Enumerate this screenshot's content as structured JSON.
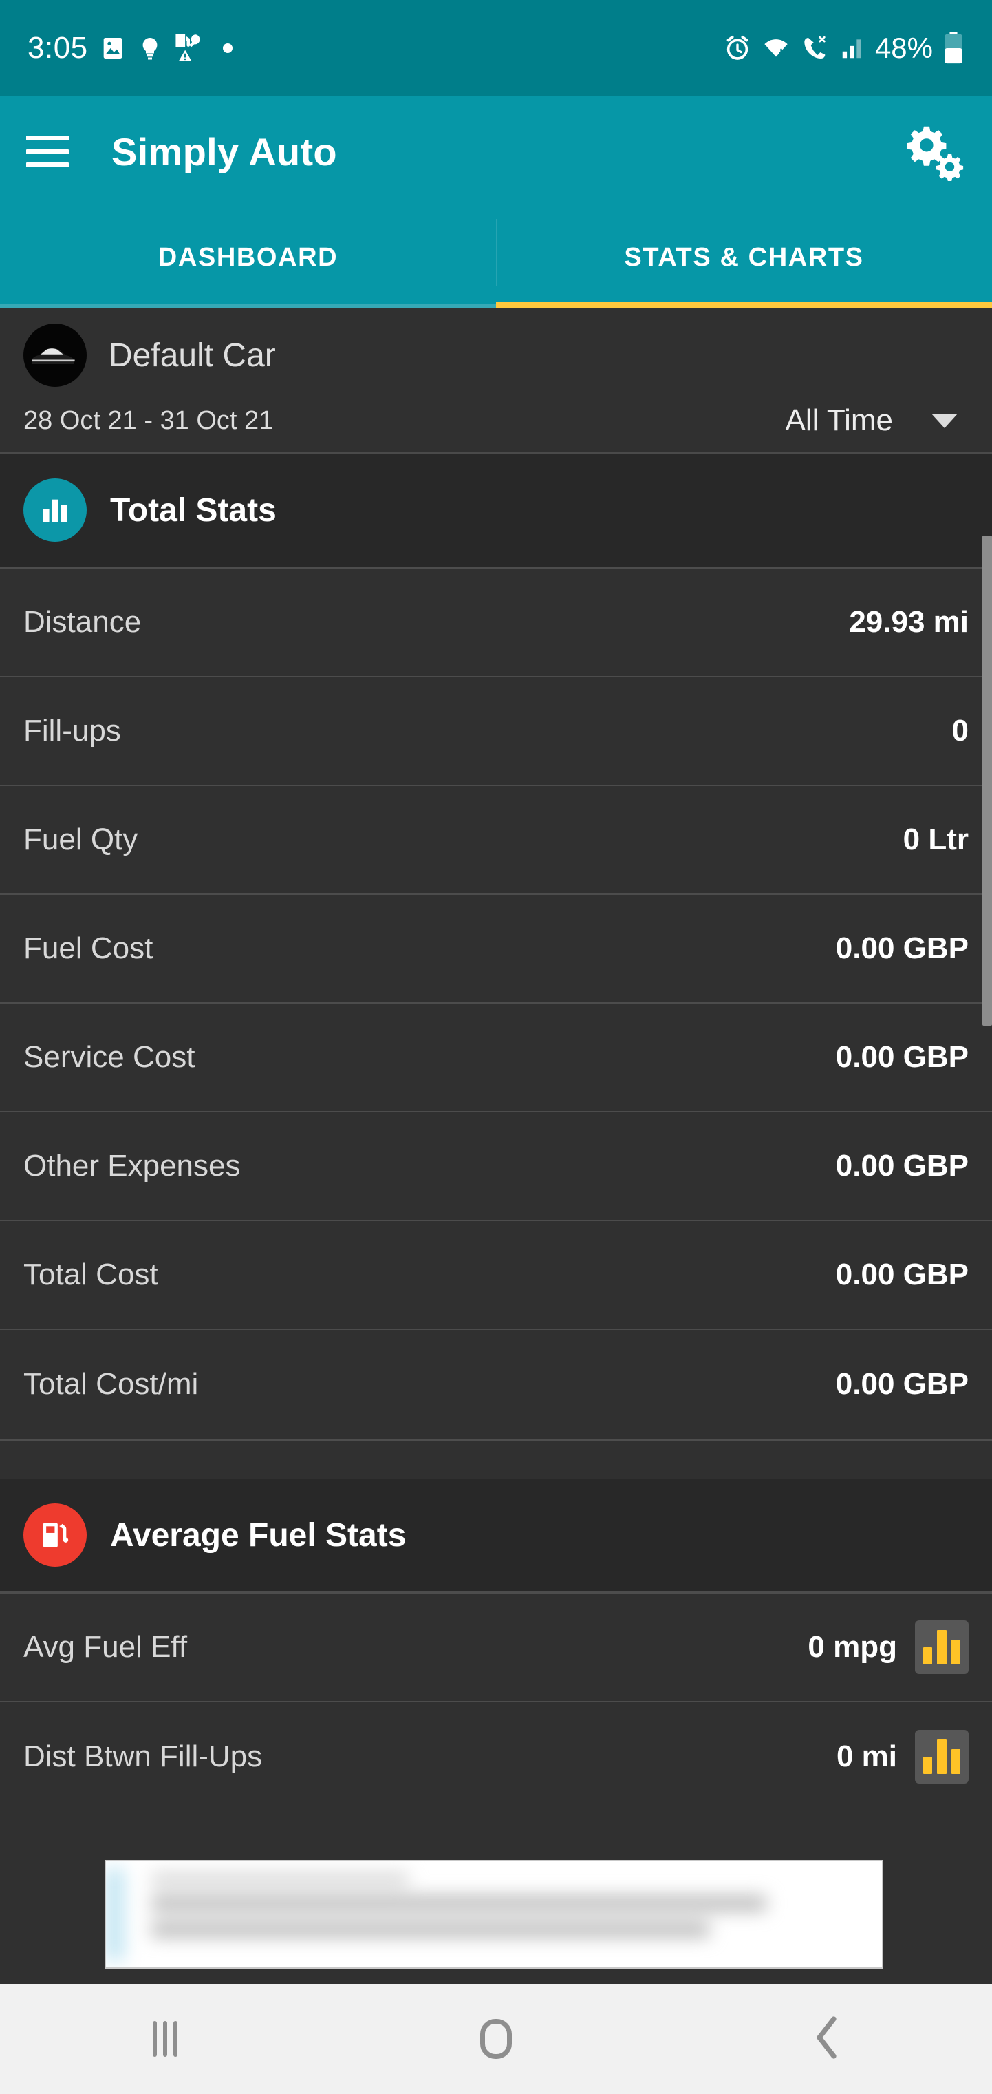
{
  "status_bar": {
    "time": "3:05",
    "battery_text": "48%",
    "left_icons": [
      "image-icon",
      "lightbulb-icon",
      "fuel-wrench-icon",
      "dot-icon"
    ],
    "right_icons": [
      "alarm-icon",
      "wifi-icon",
      "call-icon",
      "signal-icon",
      "battery-icon"
    ],
    "background": "#007E8A"
  },
  "app_bar": {
    "title": "Simply Auto",
    "menu_icon": "hamburger-menu-icon",
    "settings_icon": "gears-settings-icon",
    "background": "#0697A7"
  },
  "tabs": {
    "items": [
      {
        "label": "DASHBOARD",
        "selected": false
      },
      {
        "label": "STATS & CHARTS",
        "selected": true
      }
    ],
    "indicator_color": "#FFC83D"
  },
  "car_bar": {
    "car_name": "Default Car",
    "avatar_icon": "car-avatar-icon",
    "date_range": "28 Oct 21  -  31 Oct 21",
    "range_selector": {
      "value": "All Time",
      "caret_icon": "chevron-down-icon"
    }
  },
  "sections": [
    {
      "title": "Total Stats",
      "icon": "bar-chart-icon",
      "icon_color": "#0C97A8",
      "rows": [
        {
          "label": "Distance",
          "value": "29.93 mi",
          "chart_button": false
        },
        {
          "label": "Fill-ups",
          "value": "0",
          "chart_button": false
        },
        {
          "label": "Fuel Qty",
          "value": "0 Ltr",
          "chart_button": false
        },
        {
          "label": "Fuel Cost",
          "value": "0.00 GBP",
          "chart_button": false
        },
        {
          "label": "Service Cost",
          "value": "0.00 GBP",
          "chart_button": false
        },
        {
          "label": "Other Expenses",
          "value": "0.00 GBP",
          "chart_button": false
        },
        {
          "label": "Total Cost",
          "value": "0.00 GBP",
          "chart_button": false
        },
        {
          "label": "Total Cost/mi",
          "value": "0.00 GBP",
          "chart_button": false
        }
      ]
    },
    {
      "title": "Average Fuel Stats",
      "icon": "fuel-pump-icon",
      "icon_color": "#EE3B2E",
      "rows": [
        {
          "label": "Avg Fuel Eff",
          "value": "0 mpg",
          "chart_button": true
        },
        {
          "label": "Dist Btwn Fill-Ups",
          "value": "0 mi",
          "chart_button": true
        }
      ]
    }
  ],
  "nav_bar": {
    "items": [
      {
        "icon": "recents-icon"
      },
      {
        "icon": "home-icon"
      },
      {
        "icon": "back-icon"
      }
    ]
  }
}
